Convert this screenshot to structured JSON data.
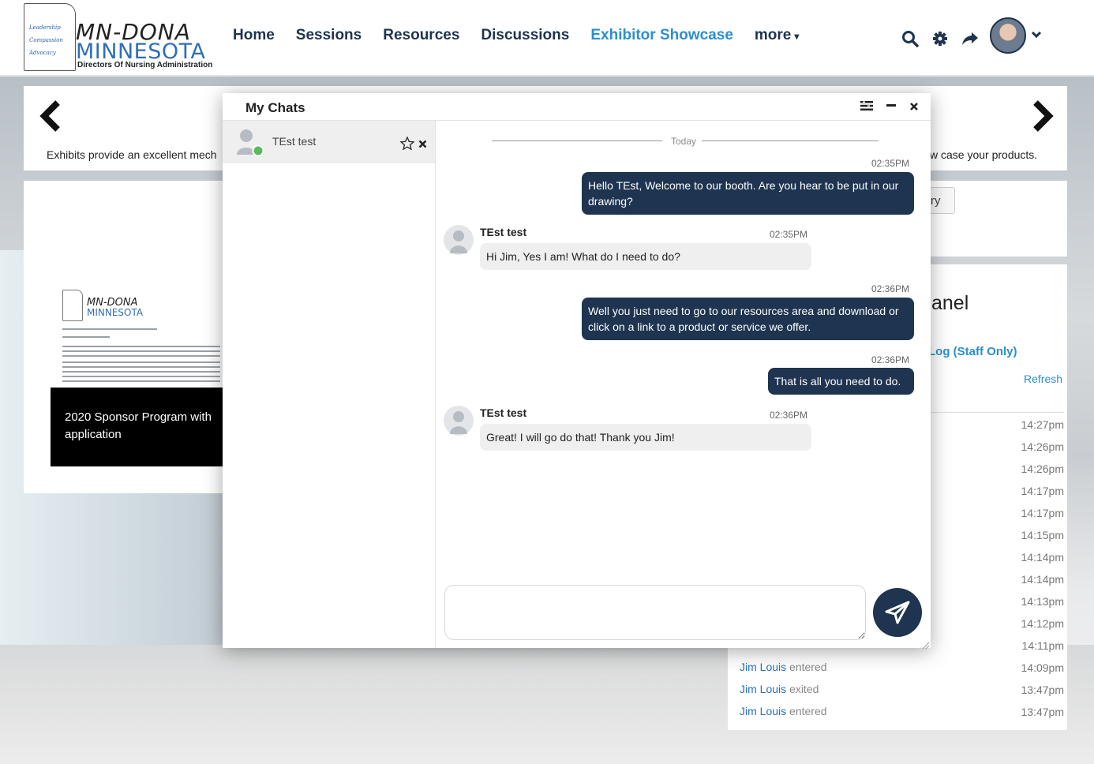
{
  "logo": {
    "state_words": [
      "Leadership",
      "Compassion",
      "Advocacy"
    ],
    "line1": "MN-DONA",
    "line2": "MINNESOTA",
    "tagline": "Directors Of Nursing Administration"
  },
  "nav": {
    "items": [
      {
        "label": "Home"
      },
      {
        "label": "Sessions"
      },
      {
        "label": "Resources"
      },
      {
        "label": "Discussions"
      },
      {
        "label": "Exhibitor Showcase",
        "active": true
      },
      {
        "label": "more"
      }
    ],
    "accent_color": "#2a8fd0",
    "text_color": "#1e3450"
  },
  "page": {
    "exhibit_text_left": "Exhibits provide an excellent mech",
    "exhibit_text_right": "w case your products.",
    "doc_logo_line1": "MN-DONA",
    "doc_logo_line2": "MINNESOTA",
    "sponsor_title": "2020 Sponsor Program with application",
    "right_button_text": "ry",
    "panel_title": "anel",
    "log_link": "Log (Staff Only)",
    "refresh": "Refresh",
    "times": [
      "14:27pm",
      "14:26pm",
      "14:26pm",
      "14:17pm",
      "14:17pm",
      "14:15pm",
      "14:14pm",
      "14:14pm",
      "14:13pm",
      "14:12pm",
      "14:11pm",
      "14:09pm",
      "13:47pm",
      "13:47pm"
    ],
    "entries": [
      {
        "name": "Jim Louis",
        "action": "entered"
      },
      {
        "name": "Jim Louis",
        "action": "exited"
      },
      {
        "name": "Jim Louis",
        "action": "entered"
      }
    ]
  },
  "chat": {
    "title": "My Chats",
    "conversation_name": "TEst test",
    "today_label": "Today",
    "messages": [
      {
        "dir": "out",
        "time": "02:35PM",
        "text": "Hello TEst, Welcome to our booth. Are you hear to be put in our drawing?"
      },
      {
        "dir": "in",
        "sender": "TEst test",
        "time": "02:35PM",
        "text": "Hi Jim, Yes I am! What do I need to do?"
      },
      {
        "dir": "out",
        "time": "02:36PM",
        "text": "Well you just need to go to our resources area and download or click on a link to a product or service we offer."
      },
      {
        "dir": "out",
        "time": "02:36PM",
        "text": "That is all you need to do."
      },
      {
        "dir": "in",
        "sender": "TEst test",
        "time": "02:36PM",
        "text": "Great! I will go do that! Thank you Jim!"
      }
    ],
    "composer_placeholder": "",
    "online_color": "#5cb85c",
    "bubble_color": "#1e3450"
  }
}
